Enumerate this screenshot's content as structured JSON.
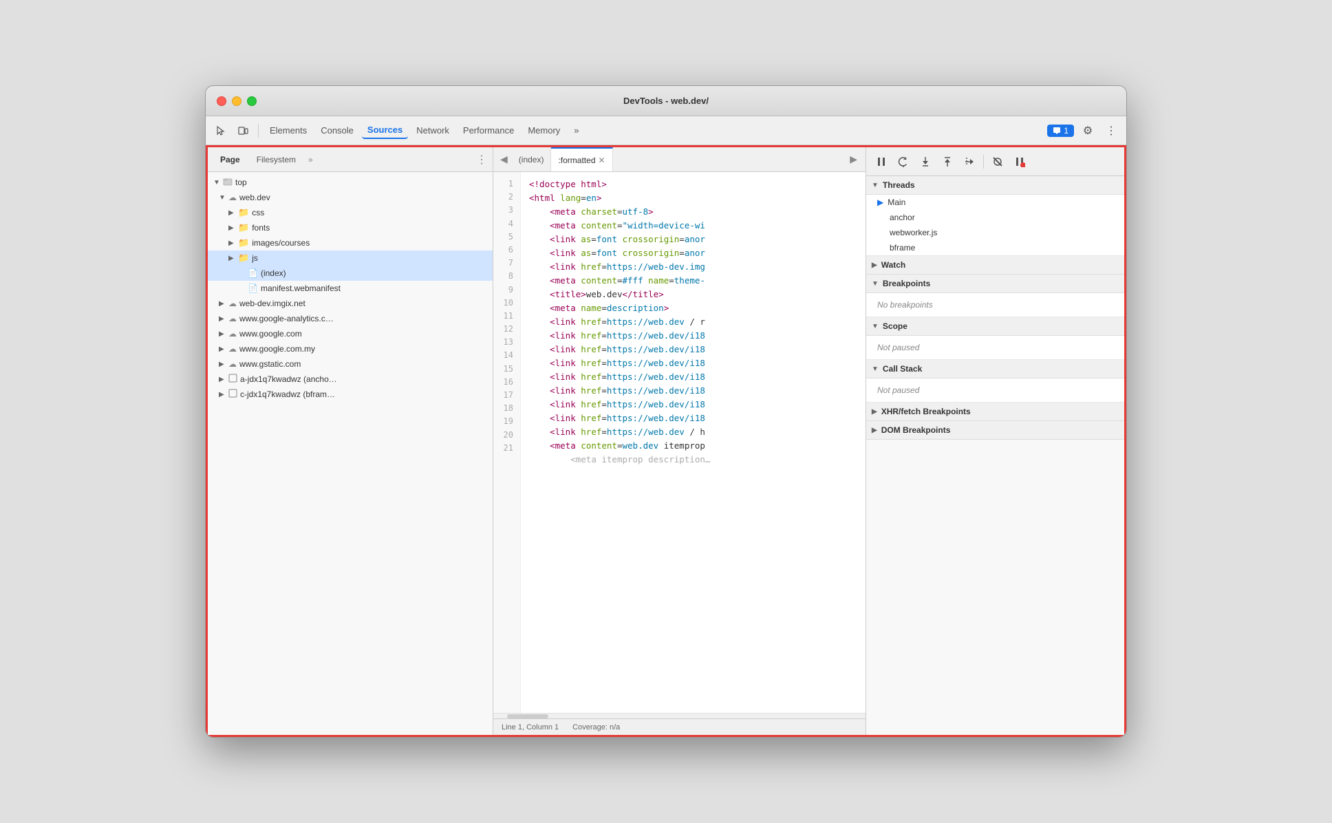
{
  "window": {
    "title": "DevTools - web.dev/"
  },
  "toolbar": {
    "tabs": [
      {
        "label": "Elements",
        "active": false
      },
      {
        "label": "Console",
        "active": false
      },
      {
        "label": "Sources",
        "active": true
      },
      {
        "label": "Network",
        "active": false
      },
      {
        "label": "Performance",
        "active": false
      },
      {
        "label": "Memory",
        "active": false
      }
    ],
    "more_label": "»",
    "notification_count": "1",
    "settings_label": "⚙",
    "menu_label": "⋮"
  },
  "left_panel": {
    "tabs": [
      "Page",
      "Filesystem"
    ],
    "more": "»",
    "menu": "⋮",
    "tree": [
      {
        "label": "top",
        "indent": 0,
        "type": "folder",
        "expanded": true,
        "arrow": "▼"
      },
      {
        "label": "web.dev",
        "indent": 1,
        "type": "cloud",
        "expanded": true,
        "arrow": "▼"
      },
      {
        "label": "css",
        "indent": 2,
        "type": "folder",
        "expanded": false,
        "arrow": "▶"
      },
      {
        "label": "fonts",
        "indent": 2,
        "type": "folder",
        "expanded": false,
        "arrow": "▶"
      },
      {
        "label": "images/courses",
        "indent": 2,
        "type": "folder",
        "expanded": false,
        "arrow": "▶"
      },
      {
        "label": "js",
        "indent": 2,
        "type": "folder",
        "expanded": false,
        "arrow": "▶",
        "selected": true
      },
      {
        "label": "(index)",
        "indent": 3,
        "type": "file",
        "expanded": false,
        "arrow": "",
        "selected": true
      },
      {
        "label": "manifest.webmanifest",
        "indent": 3,
        "type": "file",
        "expanded": false,
        "arrow": ""
      },
      {
        "label": "web-dev.imgix.net",
        "indent": 1,
        "type": "cloud",
        "expanded": false,
        "arrow": "▶"
      },
      {
        "label": "www.google-analytics.c…",
        "indent": 1,
        "type": "cloud",
        "expanded": false,
        "arrow": "▶"
      },
      {
        "label": "www.google.com",
        "indent": 1,
        "type": "cloud",
        "expanded": false,
        "arrow": "▶"
      },
      {
        "label": "www.google.com.my",
        "indent": 1,
        "type": "cloud",
        "expanded": false,
        "arrow": "▶"
      },
      {
        "label": "www.gstatic.com",
        "indent": 1,
        "type": "cloud",
        "expanded": false,
        "arrow": "▶"
      },
      {
        "label": "a-jdx1q7kwadwz (ancho…",
        "indent": 1,
        "type": "square",
        "expanded": false,
        "arrow": "▶"
      },
      {
        "label": "c-jdx1q7kwadwz (bfram…",
        "indent": 1,
        "type": "square",
        "expanded": false,
        "arrow": "▶"
      }
    ]
  },
  "editor": {
    "tabs": [
      {
        "label": "(index)",
        "active": false
      },
      {
        "label": ":formatted",
        "active": true,
        "closeable": true
      }
    ],
    "code_lines": [
      {
        "num": 1,
        "text": "<!doctype html>"
      },
      {
        "num": 2,
        "text": "<html lang=en>"
      },
      {
        "num": 3,
        "text": "    <meta charset=utf-8>"
      },
      {
        "num": 4,
        "text": "    <meta content=\"width=device-wi"
      },
      {
        "num": 5,
        "text": "    <link as=font crossorigin=anor"
      },
      {
        "num": 6,
        "text": "    <link as=font crossorigin=anor"
      },
      {
        "num": 7,
        "text": "    <link href=https://web-dev.img"
      },
      {
        "num": 8,
        "text": "    <meta content=#fff name=theme-"
      },
      {
        "num": 9,
        "text": "    <title>web.dev</title>"
      },
      {
        "num": 10,
        "text": "    <meta name=description>"
      },
      {
        "num": 11,
        "text": "    <link href=https://web.dev / r"
      },
      {
        "num": 12,
        "text": "    <link href=https://web.dev/i18"
      },
      {
        "num": 13,
        "text": "    <link href=https://web.dev/i18"
      },
      {
        "num": 14,
        "text": "    <link href=https://web.dev/i18"
      },
      {
        "num": 15,
        "text": "    <link href=https://web.dev/i18"
      },
      {
        "num": 16,
        "text": "    <link href=https://web.dev/i18"
      },
      {
        "num": 17,
        "text": "    <link href=https://web.dev/i18"
      },
      {
        "num": 18,
        "text": "    <link href=https://web.dev/i18"
      },
      {
        "num": 19,
        "text": "    <link href=https://web.dev / h"
      },
      {
        "num": 20,
        "text": "    <meta content=web.dev itemprop"
      },
      {
        "num": 21,
        "text": "    <meta itemprop description…"
      }
    ],
    "statusbar": {
      "position": "Line 1, Column 1",
      "coverage": "Coverage: n/a"
    }
  },
  "right_panel": {
    "debug_buttons": [
      {
        "icon": "⏸",
        "label": "pause"
      },
      {
        "icon": "↺",
        "label": "step-over"
      },
      {
        "icon": "↓",
        "label": "step-into"
      },
      {
        "icon": "↑",
        "label": "step-out"
      },
      {
        "icon": "⇒",
        "label": "step"
      },
      {
        "icon": "⊘",
        "label": "deactivate"
      },
      {
        "icon": "⏸",
        "label": "pause-on-exception"
      }
    ],
    "sections": {
      "threads": {
        "label": "Threads",
        "items": [
          {
            "label": "Main",
            "active": true
          },
          {
            "label": "anchor"
          },
          {
            "label": "webworker.js"
          },
          {
            "label": "bframe"
          }
        ]
      },
      "watch": {
        "label": "Watch"
      },
      "breakpoints": {
        "label": "Breakpoints",
        "empty_text": "No breakpoints"
      },
      "scope": {
        "label": "Scope",
        "not_paused": "Not paused"
      },
      "call_stack": {
        "label": "Call Stack",
        "not_paused": "Not paused"
      },
      "xhr_breakpoints": {
        "label": "XHR/fetch Breakpoints"
      },
      "dom_breakpoints": {
        "label": "DOM Breakpoints"
      }
    }
  }
}
